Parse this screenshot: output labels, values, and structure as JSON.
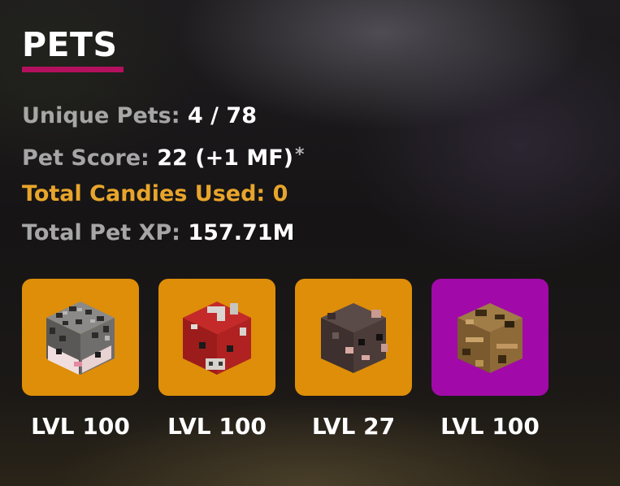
{
  "section": {
    "title": "PETS",
    "accent_color": "#b3105e"
  },
  "stats": {
    "unique_pets_label": "Unique Pets:",
    "unique_pets_value": "4 / 78",
    "pet_score_label": "Pet Score:",
    "pet_score_value": "22 (+1 MF)",
    "pet_score_note": "*",
    "candies_label": "Total Candies Used:",
    "candies_value": "0",
    "candies_color": "#e8a52b",
    "xp_label": "Total Pet XP:",
    "xp_value": "157.71M"
  },
  "pets": [
    {
      "icon": "hedgehog-icon",
      "level": "LVL 100",
      "tile_color": "#de8e08"
    },
    {
      "icon": "mooshroom-cow-icon",
      "level": "LVL 100",
      "tile_color": "#de8e08"
    },
    {
      "icon": "rat-icon",
      "level": "LVL 27",
      "tile_color": "#de8e08"
    },
    {
      "icon": "wood-crate-icon",
      "level": "LVL 100",
      "tile_color": "#a10aa8"
    }
  ]
}
